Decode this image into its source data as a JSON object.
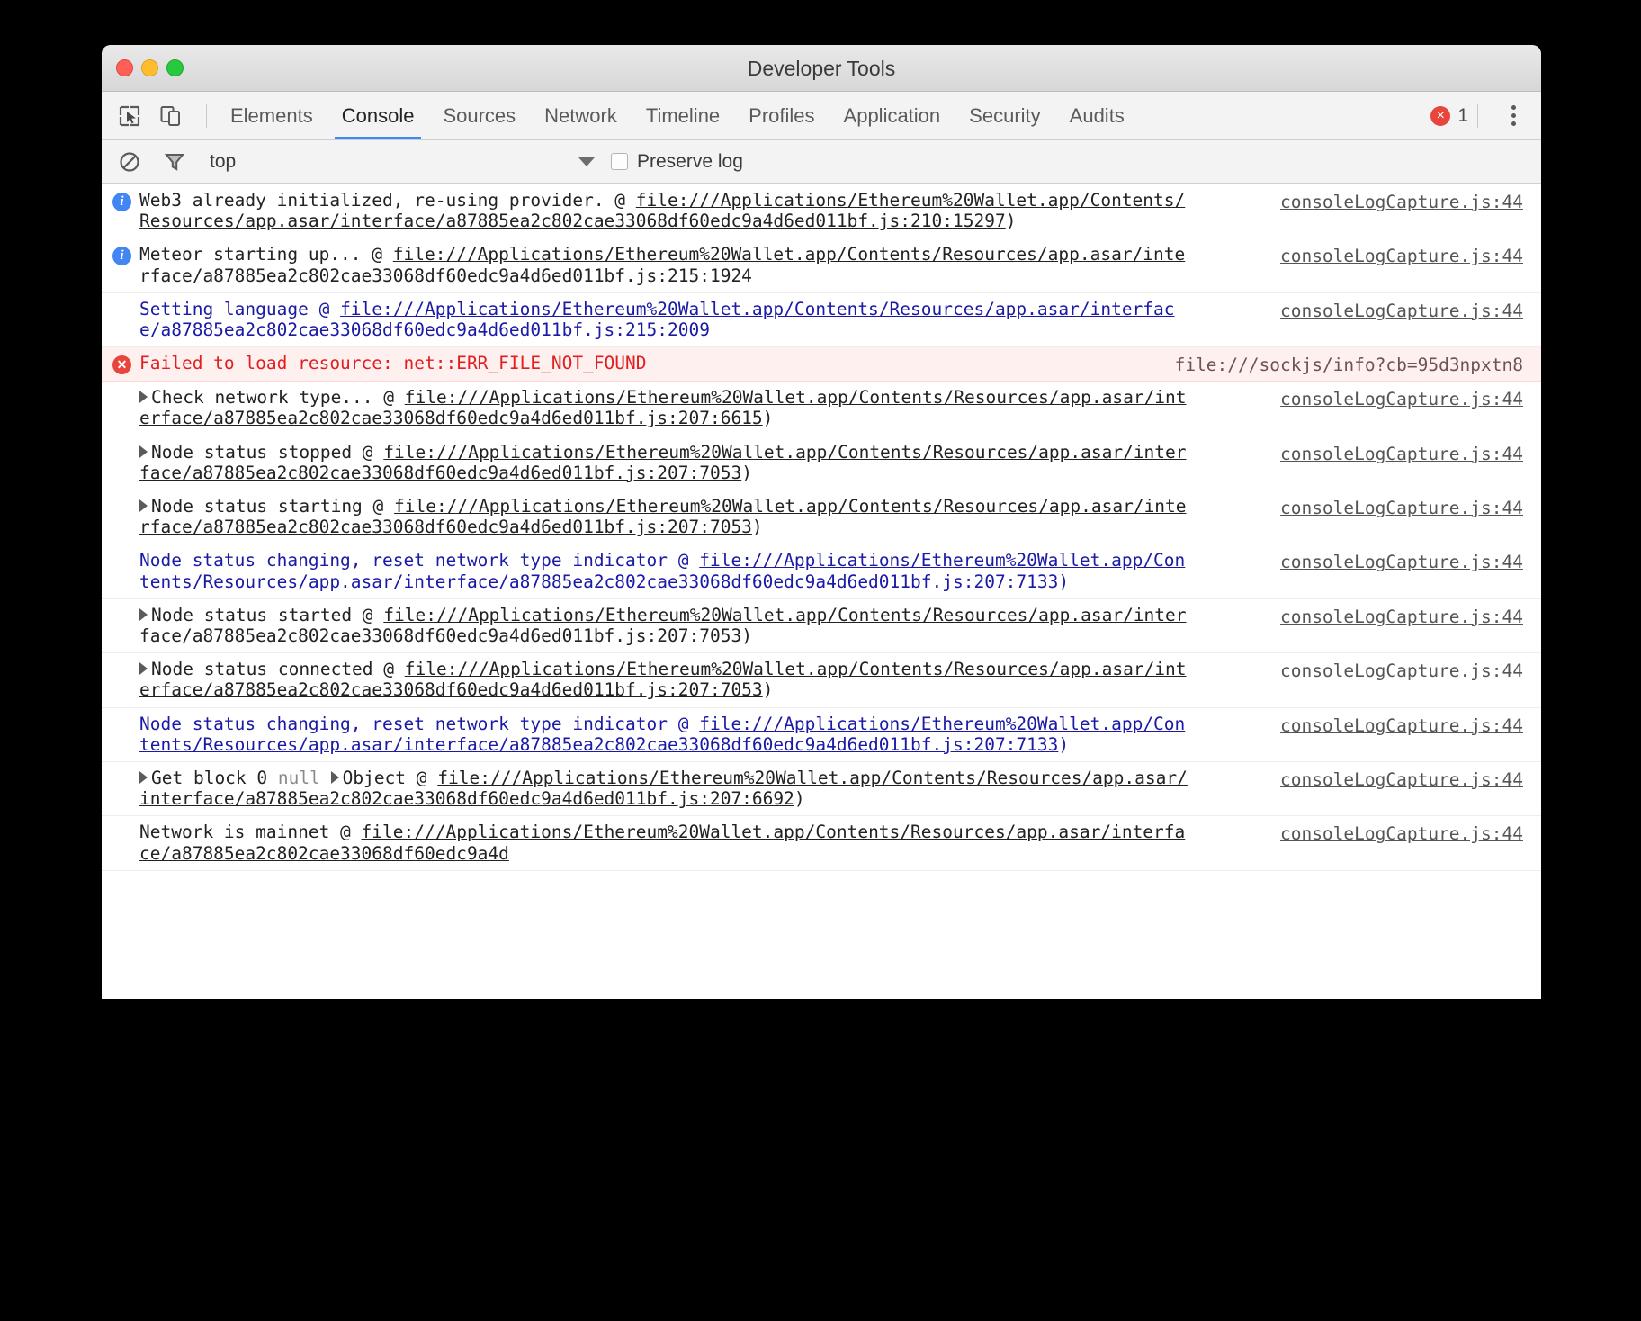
{
  "window": {
    "title": "Developer Tools",
    "traffic_lights": [
      "close-red",
      "minimize-yellow",
      "zoom-green"
    ]
  },
  "tabbar": {
    "tools": [
      {
        "name": "inspect-element-icon",
        "label": "Inspect element"
      },
      {
        "name": "toggle-device-toolbar-icon",
        "label": "Toggle device toolbar"
      }
    ],
    "tabs": [
      {
        "label": "Elements",
        "active": false
      },
      {
        "label": "Console",
        "active": true
      },
      {
        "label": "Sources",
        "active": false
      },
      {
        "label": "Network",
        "active": false
      },
      {
        "label": "Timeline",
        "active": false
      },
      {
        "label": "Profiles",
        "active": false
      },
      {
        "label": "Application",
        "active": false
      },
      {
        "label": "Security",
        "active": false
      },
      {
        "label": "Audits",
        "active": false
      }
    ],
    "error_count": "1",
    "error_glyph": "×",
    "menu_label": "Customize and control DevTools"
  },
  "filterbar": {
    "clear_console_label": "Clear console",
    "filter_label": "Filter",
    "context": "top",
    "context_dropdown_label": "Select JavaScript context",
    "preserve_log_label": "Preserve log",
    "preserve_log_checked": false
  },
  "console": {
    "messages": [
      {
        "level": "info",
        "icon": "info-icon",
        "expandable": false,
        "text": "Web3 already initialized, re-using provider. @ ",
        "link": "file:///Applications/Ethereum%20Wallet.app/Contents/Resources/app.asar/interface/a87885ea2c802cae33068df60edc9a4d6ed011bf.js:210:15297",
        "suffix": ")",
        "source": "consoleLogCapture.js:44"
      },
      {
        "level": "info",
        "icon": "info-icon",
        "expandable": false,
        "text": "Meteor starting up... @ ",
        "link": "file:///Applications/Ethereum%20Wallet.app/Contents/Resources/app.asar/interface/a87885ea2c802cae33068df60edc9a4d6ed011bf.js:215:1924",
        "suffix": "",
        "source": "consoleLogCapture.js:44"
      },
      {
        "level": "log-blue",
        "icon": "none",
        "expandable": false,
        "text": "Setting language @ ",
        "link": "file:///Applications/Ethereum%20Wallet.app/Contents/Resources/app.asar/interface/a87885ea2c802cae33068df60edc9a4d6ed011bf.js:215:2009",
        "suffix": "",
        "source": "consoleLogCapture.js:44"
      },
      {
        "level": "error",
        "icon": "error-icon",
        "expandable": false,
        "text": "Failed to load resource: net::ERR_FILE_NOT_FOUND",
        "link": "",
        "suffix": "",
        "source": "file:///sockjs/info?cb=95d3npxtn8"
      },
      {
        "level": "log",
        "icon": "none",
        "expandable": true,
        "text": "Check network type... @ ",
        "link": "file:///Applications/Ethereum%20Wallet.app/Contents/Resources/app.asar/interface/a87885ea2c802cae33068df60edc9a4d6ed011bf.js:207:6615",
        "suffix": ")",
        "source": "consoleLogCapture.js:44"
      },
      {
        "level": "log",
        "icon": "none",
        "expandable": true,
        "text": "Node status stopped @ ",
        "link": "file:///Applications/Ethereum%20Wallet.app/Contents/Resources/app.asar/interface/a87885ea2c802cae33068df60edc9a4d6ed011bf.js:207:7053",
        "suffix": ")",
        "source": "consoleLogCapture.js:44"
      },
      {
        "level": "log",
        "icon": "none",
        "expandable": true,
        "text": "Node status starting @ ",
        "link": "file:///Applications/Ethereum%20Wallet.app/Contents/Resources/app.asar/interface/a87885ea2c802cae33068df60edc9a4d6ed011bf.js:207:7053",
        "suffix": ")",
        "source": "consoleLogCapture.js:44"
      },
      {
        "level": "log-blue",
        "icon": "none",
        "expandable": false,
        "text": "Node status changing, reset network type indicator @ ",
        "link": "file:///Applications/Ethereum%20Wallet.app/Contents/Resources/app.asar/interface/a87885ea2c802cae33068df60edc9a4d6ed011bf.js:207:7133",
        "suffix": ")",
        "source": "consoleLogCapture.js:44"
      },
      {
        "level": "log",
        "icon": "none",
        "expandable": true,
        "text": "Node status started @ ",
        "link": "file:///Applications/Ethereum%20Wallet.app/Contents/Resources/app.asar/interface/a87885ea2c802cae33068df60edc9a4d6ed011bf.js:207:7053",
        "suffix": ")",
        "source": "consoleLogCapture.js:44"
      },
      {
        "level": "log",
        "icon": "none",
        "expandable": true,
        "text": "Node status connected @ ",
        "link": "file:///Applications/Ethereum%20Wallet.app/Contents/Resources/app.asar/interface/a87885ea2c802cae33068df60edc9a4d6ed011bf.js:207:7053",
        "suffix": ")",
        "source": "consoleLogCapture.js:44"
      },
      {
        "level": "log-blue",
        "icon": "none",
        "expandable": false,
        "text": "Node status changing, reset network type indicator @ ",
        "link": "file:///Applications/Ethereum%20Wallet.app/Contents/Resources/app.asar/interface/a87885ea2c802cae33068df60edc9a4d6ed011bf.js:207:7133",
        "suffix": ")",
        "source": "consoleLogCapture.js:44"
      },
      {
        "level": "log-object",
        "icon": "none",
        "expandable": true,
        "text": "Get block 0 ",
        "null_token": "null",
        "object_token": "Object",
        "after_object": " @ ",
        "link": "file:///Applications/Ethereum%20Wallet.app/Contents/Resources/app.asar/interface/a87885ea2c802cae33068df60edc9a4d6ed011bf.js:207:6692",
        "suffix": ")",
        "source": "consoleLogCapture.js:44"
      },
      {
        "level": "log",
        "icon": "none",
        "expandable": false,
        "text": "Network is mainnet @ ",
        "link": "file:///Applications/Ethereum%20Wallet.app/Contents/Resources/app.asar/interface/a87885ea2c802cae33068df60edc9a4d",
        "suffix": "",
        "source": "consoleLogCapture.js:44"
      }
    ]
  },
  "colors": {
    "error_red": "#e02020",
    "error_bg": "#fff0f0",
    "info_blue": "#4285f4",
    "log_blue": "#1a1aa6",
    "accent_tab": "#3b88fd",
    "traffic_red": "#ff5f57",
    "traffic_yellow": "#ffbd2e",
    "traffic_green": "#28c840"
  }
}
